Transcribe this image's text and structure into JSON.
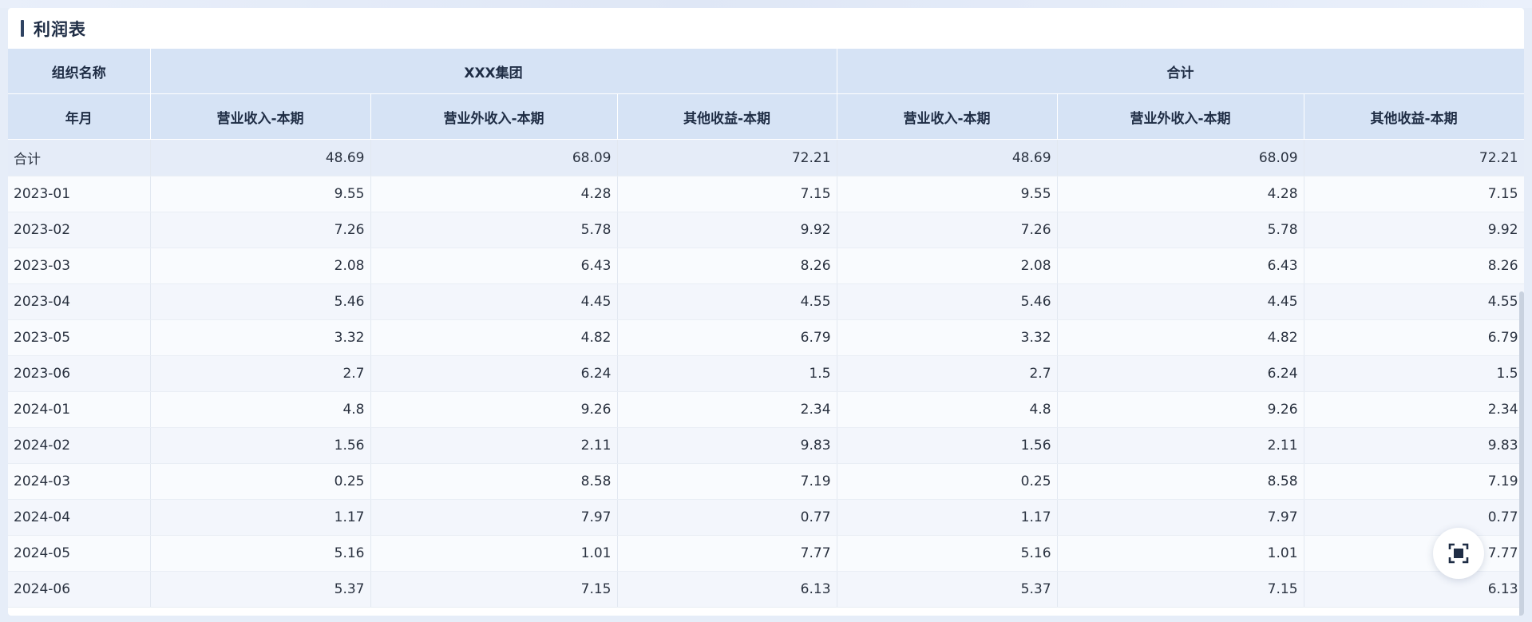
{
  "title": "利润表",
  "header": {
    "org_label": "组织名称",
    "period_label": "年月",
    "groups": [
      "XXX集团",
      "合计"
    ],
    "columns": [
      "营业收入-本期",
      "营业外收入-本期",
      "其他收益-本期",
      "营业收入-本期",
      "营业外收入-本期",
      "其他收益-本期"
    ]
  },
  "total": {
    "label": "合计",
    "values": [
      "48.69",
      "68.09",
      "72.21",
      "48.69",
      "68.09",
      "72.21"
    ]
  },
  "rows": [
    {
      "label": "2023-01",
      "values": [
        "9.55",
        "4.28",
        "7.15",
        "9.55",
        "4.28",
        "7.15"
      ]
    },
    {
      "label": "2023-02",
      "values": [
        "7.26",
        "5.78",
        "9.92",
        "7.26",
        "5.78",
        "9.92"
      ]
    },
    {
      "label": "2023-03",
      "values": [
        "2.08",
        "6.43",
        "8.26",
        "2.08",
        "6.43",
        "8.26"
      ]
    },
    {
      "label": "2023-04",
      "values": [
        "5.46",
        "4.45",
        "4.55",
        "5.46",
        "4.45",
        "4.55"
      ]
    },
    {
      "label": "2023-05",
      "values": [
        "3.32",
        "4.82",
        "6.79",
        "3.32",
        "4.82",
        "6.79"
      ]
    },
    {
      "label": "2023-06",
      "values": [
        "2.7",
        "6.24",
        "1.5",
        "2.7",
        "6.24",
        "1.5"
      ]
    },
    {
      "label": "2024-01",
      "values": [
        "4.8",
        "9.26",
        "2.34",
        "4.8",
        "9.26",
        "2.34"
      ]
    },
    {
      "label": "2024-02",
      "values": [
        "1.56",
        "2.11",
        "9.83",
        "1.56",
        "2.11",
        "9.83"
      ]
    },
    {
      "label": "2024-03",
      "values": [
        "0.25",
        "8.58",
        "7.19",
        "0.25",
        "8.58",
        "7.19"
      ]
    },
    {
      "label": "2024-04",
      "values": [
        "1.17",
        "7.97",
        "0.77",
        "1.17",
        "7.97",
        "0.77"
      ]
    },
    {
      "label": "2024-05",
      "values": [
        "5.16",
        "1.01",
        "7.77",
        "5.16",
        "1.01",
        "7.77"
      ]
    },
    {
      "label": "2024-06",
      "values": [
        "5.37",
        "7.15",
        "6.13",
        "5.37",
        "7.15",
        "6.13"
      ]
    }
  ],
  "icons": {
    "fullscreen": "fullscreen-icon"
  },
  "colors": {
    "header_bg": "#d6e3f5",
    "total_bg": "#e5ecf8",
    "title_mark": "#2f4362"
  }
}
